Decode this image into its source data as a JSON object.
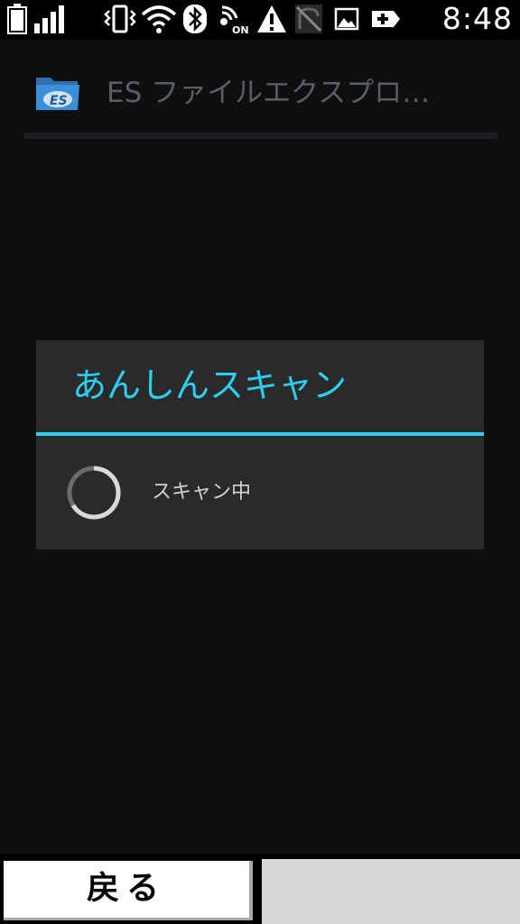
{
  "status_bar": {
    "time": "8:48",
    "icons": [
      "battery-icon",
      "signal-icon",
      "vibrate-icon",
      "wifi-icon",
      "bluetooth-icon",
      "nfc-on-icon",
      "warning-icon",
      "no-signal-icon",
      "image-icon",
      "add-icon"
    ],
    "nfc_label": "ON"
  },
  "app_header": {
    "title": "ES ファイルエクスプロ…",
    "logo_text": "ES",
    "logo_color": "#3b8fd6"
  },
  "dialog": {
    "title": "あんしんスキャン",
    "message": "スキャン中",
    "accent_color": "#2ad0ee"
  },
  "softkeys": {
    "back_label": "戻る"
  }
}
